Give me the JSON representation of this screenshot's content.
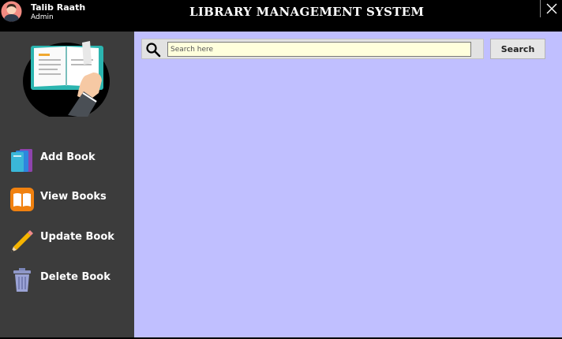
{
  "user": {
    "name": "Talib Raath",
    "role": "Admin",
    "avatar_icon": "user-avatar-icon"
  },
  "app": {
    "title": "Library Management System",
    "close_icon": "close-icon",
    "logo_icon": "book-logo-icon"
  },
  "sidebar": {
    "items": [
      {
        "label": "Add Book",
        "icon": "books-stack-icon"
      },
      {
        "label": "View Books",
        "icon": "open-book-icon"
      },
      {
        "label": "Update Book",
        "icon": "pencil-icon"
      },
      {
        "label": "Delete Book",
        "icon": "trash-icon"
      }
    ]
  },
  "search": {
    "placeholder": "Search here",
    "value": "",
    "button_label": "Search",
    "icon": "search-icon"
  },
  "colors": {
    "sidebar_bg": "#3c3c3c",
    "main_bg": "#c0bfff",
    "titlebar_bg": "#000000",
    "input_bg": "#ffffdc"
  }
}
